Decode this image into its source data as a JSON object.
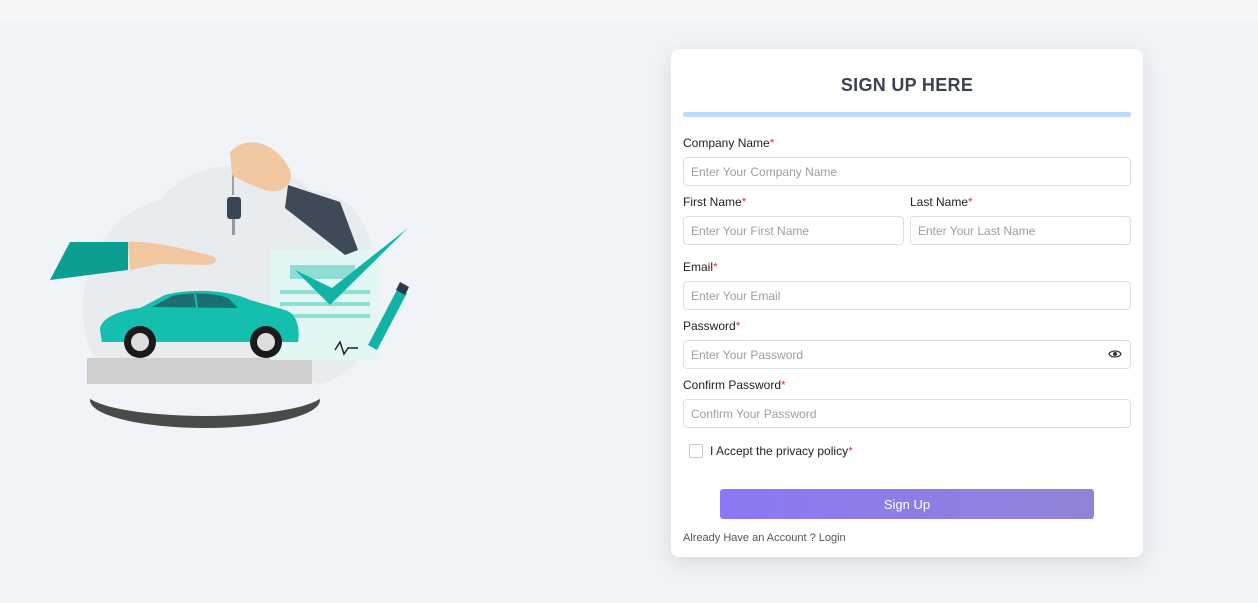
{
  "form": {
    "title": "SIGN UP HERE",
    "required_mark": "*",
    "company": {
      "label": "Company Name",
      "placeholder": "Enter Your Company Name"
    },
    "first_name": {
      "label": "First Name",
      "placeholder": "Enter Your First Name"
    },
    "last_name": {
      "label": "Last Name",
      "placeholder": "Enter Your Last Name"
    },
    "email": {
      "label": "Email",
      "placeholder": "Enter Your Email"
    },
    "password": {
      "label": "Password",
      "placeholder": "Enter Your Password"
    },
    "confirm_password": {
      "label": "Confirm Password",
      "placeholder": "Confirm Your Password"
    },
    "privacy": {
      "label": "I Accept the privacy policy",
      "checked": false
    },
    "submit_label": "Sign Up",
    "login_prompt": "Already Have an Account ? ",
    "login_link": "Login"
  },
  "icons": {
    "password_toggle": "eye-icon"
  },
  "colors": {
    "accent": "#8a78f5",
    "title_bar": "#bcd9f7",
    "required": "#e53935",
    "illustration_teal": "#12b3a5"
  }
}
